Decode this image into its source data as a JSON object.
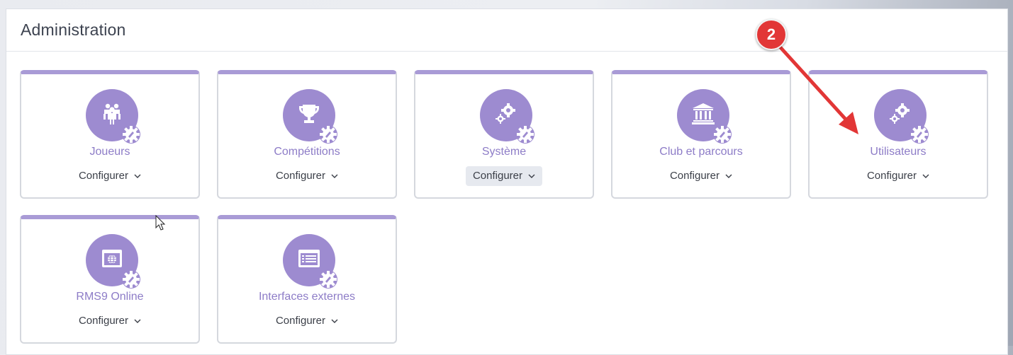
{
  "panel": {
    "title": "Administration"
  },
  "configure_label": "Configurer",
  "cards": [
    {
      "label": "Joueurs",
      "icon": "players-icon"
    },
    {
      "label": "Compétitions",
      "icon": "trophy-icon"
    },
    {
      "label": "Système",
      "icon": "gears-icon",
      "active": true
    },
    {
      "label": "Club et parcours",
      "icon": "building-icon"
    },
    {
      "label": "Utilisateurs",
      "icon": "gears-icon"
    },
    {
      "label": "RMS9 Online",
      "icon": "globe-window-icon"
    },
    {
      "label": "Interfaces externes",
      "icon": "list-window-icon"
    }
  ],
  "annotation": {
    "number": "2",
    "color": "#e23636"
  },
  "colors": {
    "accent": "#9d8bd0",
    "card_top": "#a99bd6",
    "label": "#8d7cc7"
  }
}
